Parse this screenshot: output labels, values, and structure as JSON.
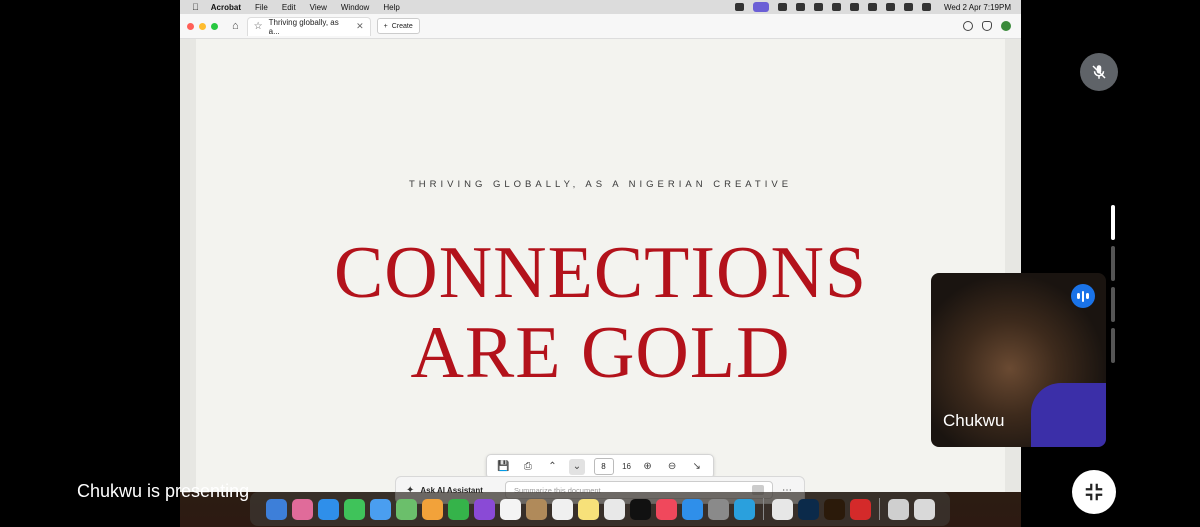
{
  "menubar": {
    "app_name": "Acrobat",
    "menus": [
      "File",
      "Edit",
      "View",
      "Window",
      "Help"
    ],
    "clock": "Wed 2 Apr  7:19PM"
  },
  "tabbar": {
    "tab_title": "Thriving globally, as a...",
    "create_label": "Create"
  },
  "document": {
    "kicker": "THRIVING GLOBALLY, AS A NIGERIAN CREATIVE",
    "headline_line1": "CONNECTIONS",
    "headline_line2": "ARE GOLD",
    "headline_color": "#b3121b"
  },
  "page_nav": {
    "current_page": "8",
    "total_pages": "16"
  },
  "ai_assistant": {
    "label": "Ask AI Assistant",
    "placeholder": "Summarize this document"
  },
  "meeting": {
    "presenting_text": "Chukwu is presenting",
    "participant_name": "Chukwu"
  },
  "colors": {
    "traffic_red": "#ff5f57",
    "traffic_yellow": "#febc2e",
    "traffic_green": "#28c840",
    "accent_blue": "#1a73e8"
  }
}
